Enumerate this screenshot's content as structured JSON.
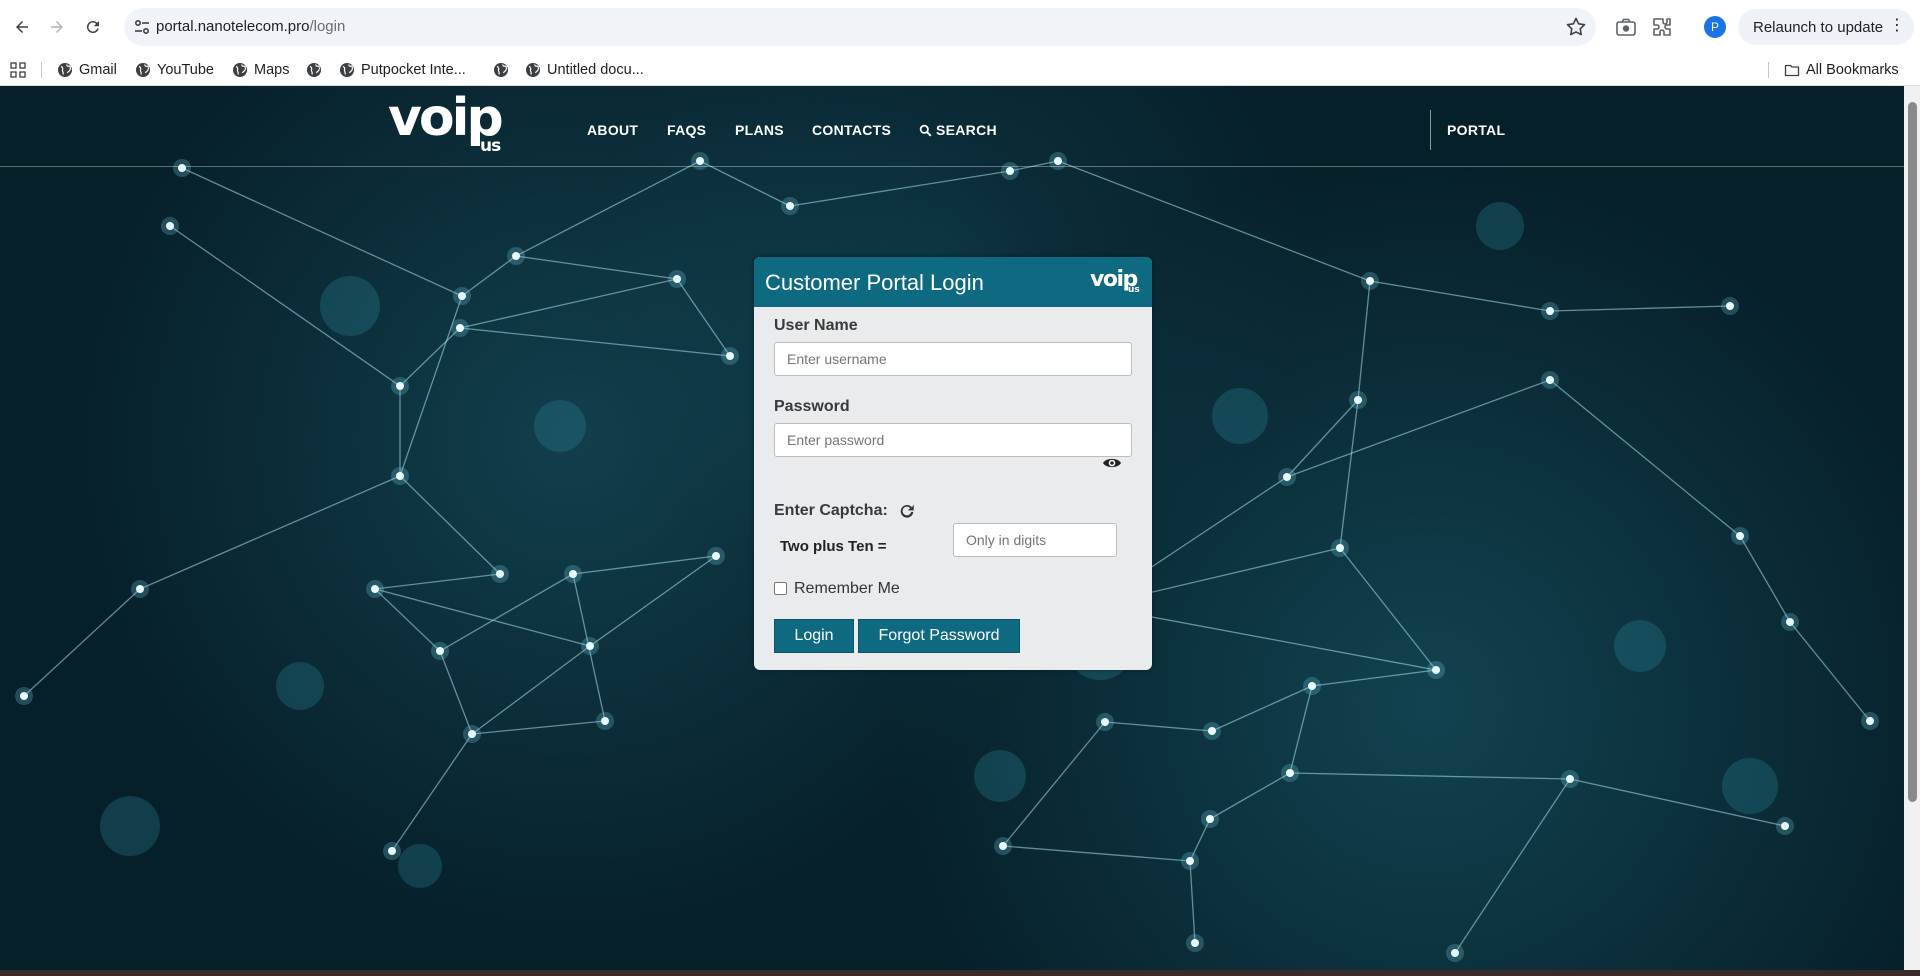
{
  "browser": {
    "url_host": "portal.nanotelecom.pro",
    "url_path": "/login",
    "avatar_letter": "P",
    "relaunch_label": "Relaunch to update",
    "icons": [
      "back-icon",
      "forward-icon",
      "reload-icon",
      "site-info-icon",
      "star-icon",
      "screenshot-icon",
      "extensions-icon",
      "more-icon"
    ]
  },
  "bookmarks": {
    "items": [
      {
        "label": "Gmail"
      },
      {
        "label": "YouTube"
      },
      {
        "label": "Maps"
      },
      {
        "label": ""
      },
      {
        "label": "Putpocket Inte..."
      },
      {
        "label": ""
      },
      {
        "label": "Untitled docu..."
      }
    ],
    "all_label": "All Bookmarks"
  },
  "site": {
    "logo_main": "voip",
    "logo_sub": "us",
    "nav": {
      "about": "ABOUT",
      "faqs": "FAQS",
      "plans": "PLANS",
      "contacts": "CONTACTS",
      "search": "SEARCH",
      "portal": "PORTAL"
    }
  },
  "login": {
    "title": "Customer Portal Login",
    "logo_main": "voip",
    "logo_sub": "us",
    "username_label": "User Name",
    "username_placeholder": "Enter username",
    "password_label": "Password",
    "password_placeholder": "Enter password",
    "captcha_label": "Enter Captcha:",
    "captcha_question": "Two plus Ten =",
    "captcha_placeholder": "Only in digits",
    "remember_label": "Remember Me",
    "login_button": "Login",
    "forgot_button": "Forgot Password"
  },
  "colors": {
    "accent": "#0e6a80",
    "page_bg": "#06202a",
    "card_bg": "#e9ebed"
  }
}
